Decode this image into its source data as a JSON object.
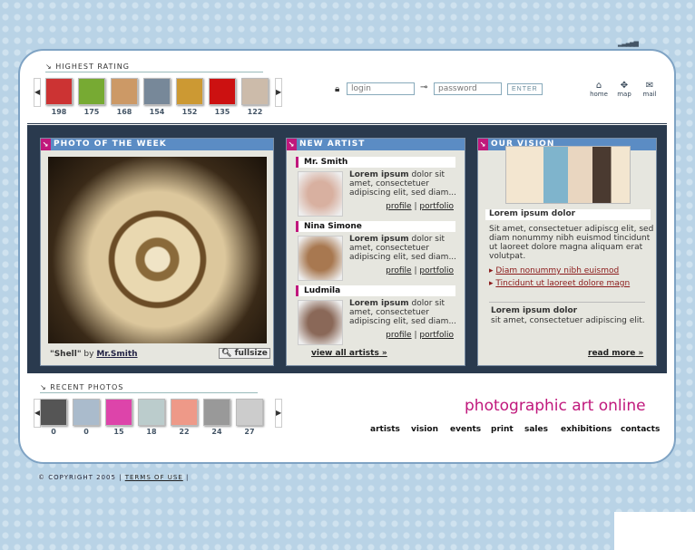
{
  "header": {
    "highest_rating_label": "HIGHEST RATING",
    "highest_rating": [
      198,
      175,
      168,
      154,
      152,
      135,
      122
    ],
    "login_placeholder": "login",
    "password_placeholder": "password",
    "enter_label": "ENTER",
    "icons": [
      {
        "icon": "home-icon",
        "label": "home"
      },
      {
        "icon": "map-icon",
        "label": "map"
      },
      {
        "icon": "mail-icon",
        "label": "mail"
      }
    ]
  },
  "photo_of_week": {
    "title": "PHOTO OF THE WEEK",
    "photo_title": "\"Shell\"",
    "by": "by",
    "author": "Mr.Smith",
    "fullsize": "fullsize"
  },
  "new_artist": {
    "title": "NEW ARTIST",
    "artists": [
      {
        "name": "Mr. Smith",
        "bold": "Lorem ipsum",
        "text": " dolor sit amet, consectetuer adipiscing elit, sed diam...",
        "profile": "profile",
        "portfolio": "portfolio"
      },
      {
        "name": "Nina Simone",
        "bold": "Lorem ipsum",
        "text": " dolor sit amet, consectetuer adipiscing elit, sed diam...",
        "profile": "profile",
        "portfolio": "portfolio"
      },
      {
        "name": "Ludmila",
        "bold": "Lorem ipsum",
        "text": " dolor sit amet, consectetuer adipiscing elit, sed diam...",
        "profile": "profile",
        "portfolio": "portfolio"
      }
    ],
    "view_all": "view all artists"
  },
  "our_vision": {
    "title": "OUR VISION",
    "heading": "Lorem ipsum dolor",
    "body": "Sit amet, consectetuer adipiscg elit, sed diam nonummy nibh euismod tincidunt ut laoreet dolore magna aliquam erat volutpat.",
    "links": [
      "Diam nonummy nibh euismod",
      "Tincidunt ut laoreet dolore magn"
    ],
    "heading2": "Lorem ipsum dolor",
    "body2": "sit amet, consectetuer adipiscing elit.",
    "read_more": "read more"
  },
  "recent_photos": {
    "label": "RECENT PHOTOS",
    "counts": [
      0,
      0,
      15,
      18,
      22,
      24,
      27
    ]
  },
  "brand": "photographic art online",
  "nav": [
    "artists",
    "vision",
    "events",
    "print",
    "sales",
    "exhibitions",
    "contacts"
  ],
  "footer": {
    "copyright": "© COPYRIGHT  2005 |",
    "terms": "TERMS OF USE",
    "sep": "|"
  },
  "colors": {
    "accent": "#c0187c",
    "header_blue": "#5b8cc4",
    "navy": "#2a3a4e",
    "link_red": "#8b1a1a"
  }
}
